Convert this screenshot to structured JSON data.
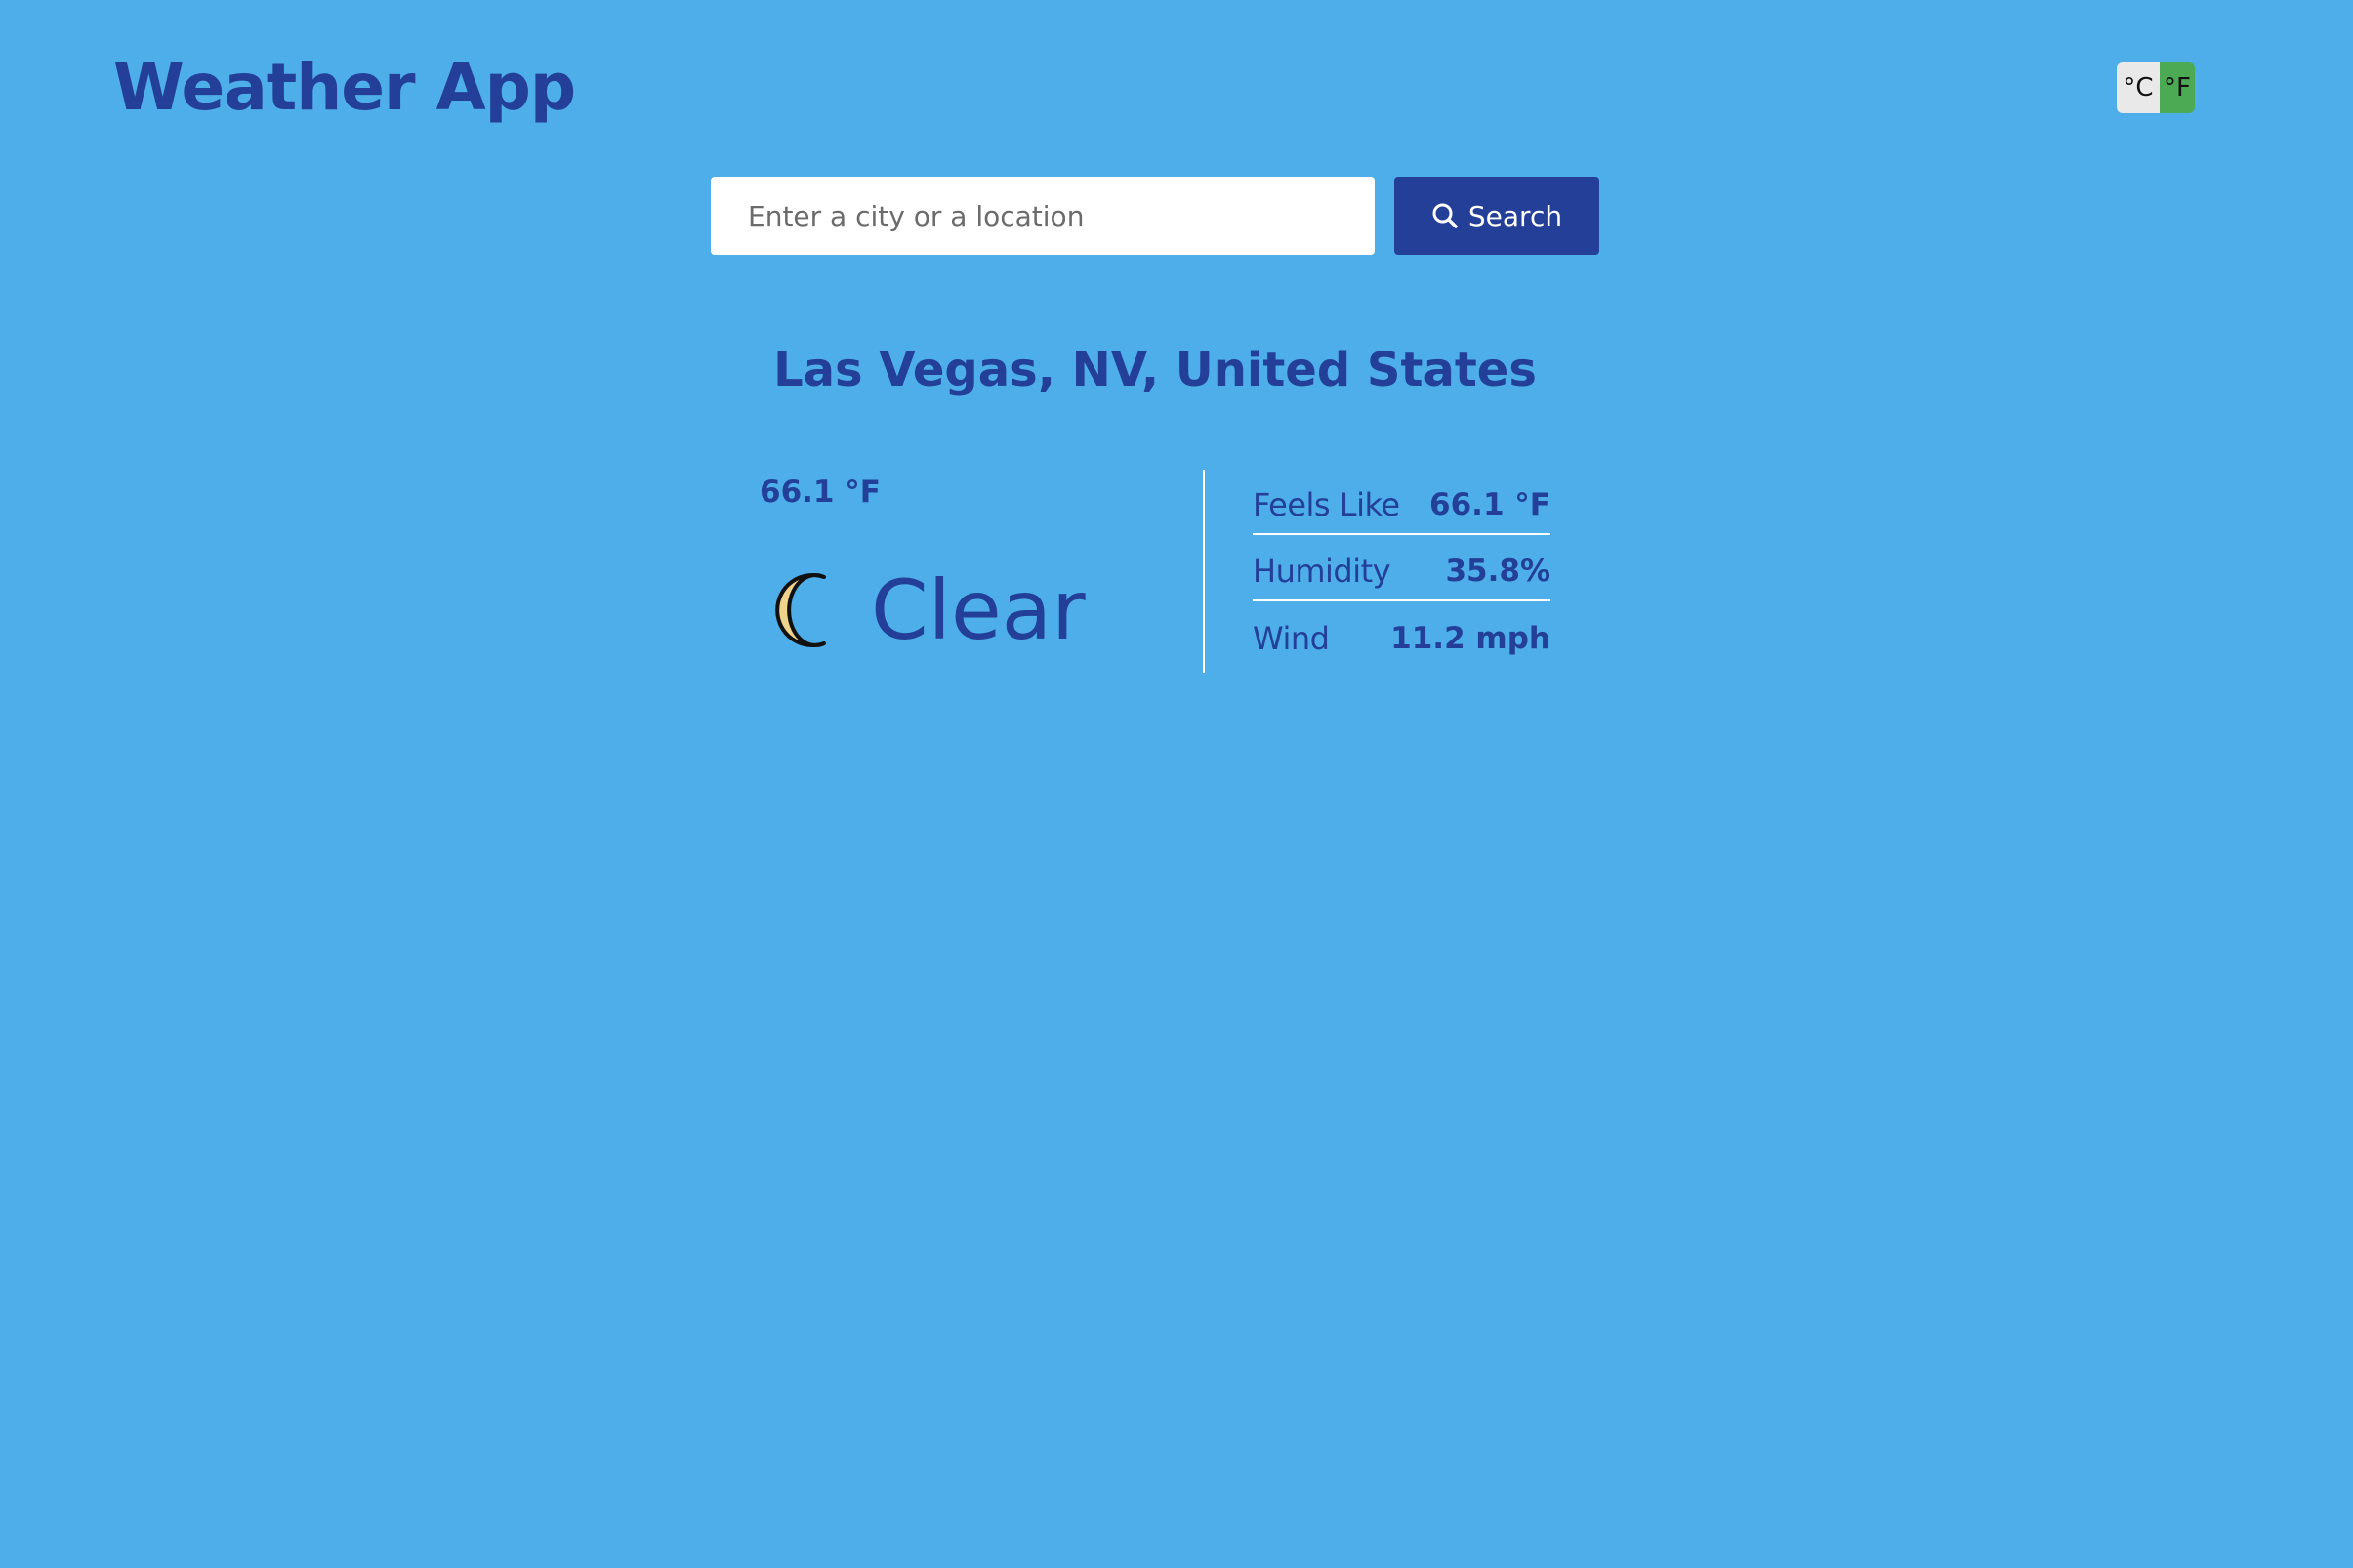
{
  "header": {
    "title": "Weather App",
    "unit_toggle": {
      "celsius_label": "°C",
      "fahrenheit_label": "°F",
      "selected": "°F"
    }
  },
  "search": {
    "placeholder": "Enter a city or a location",
    "value": "",
    "button_label": "Search",
    "button_icon": "search-icon"
  },
  "location": {
    "name": "Las Vegas, NV, United States"
  },
  "current": {
    "temperature": "66.1 °F",
    "condition": "Clear",
    "condition_icon": "moon-icon"
  },
  "details": [
    {
      "label": "Feels Like",
      "value": "66.1 °F"
    },
    {
      "label": "Humidity",
      "value": "35.8%"
    },
    {
      "label": "Wind",
      "value": "11.2 mph"
    }
  ],
  "colors": {
    "background": "#4eaeea",
    "primary": "#233f97",
    "toggle_active": "#4caa55",
    "toggle_inactive": "#e9e9e9",
    "moon_fill": "#efd28c"
  }
}
